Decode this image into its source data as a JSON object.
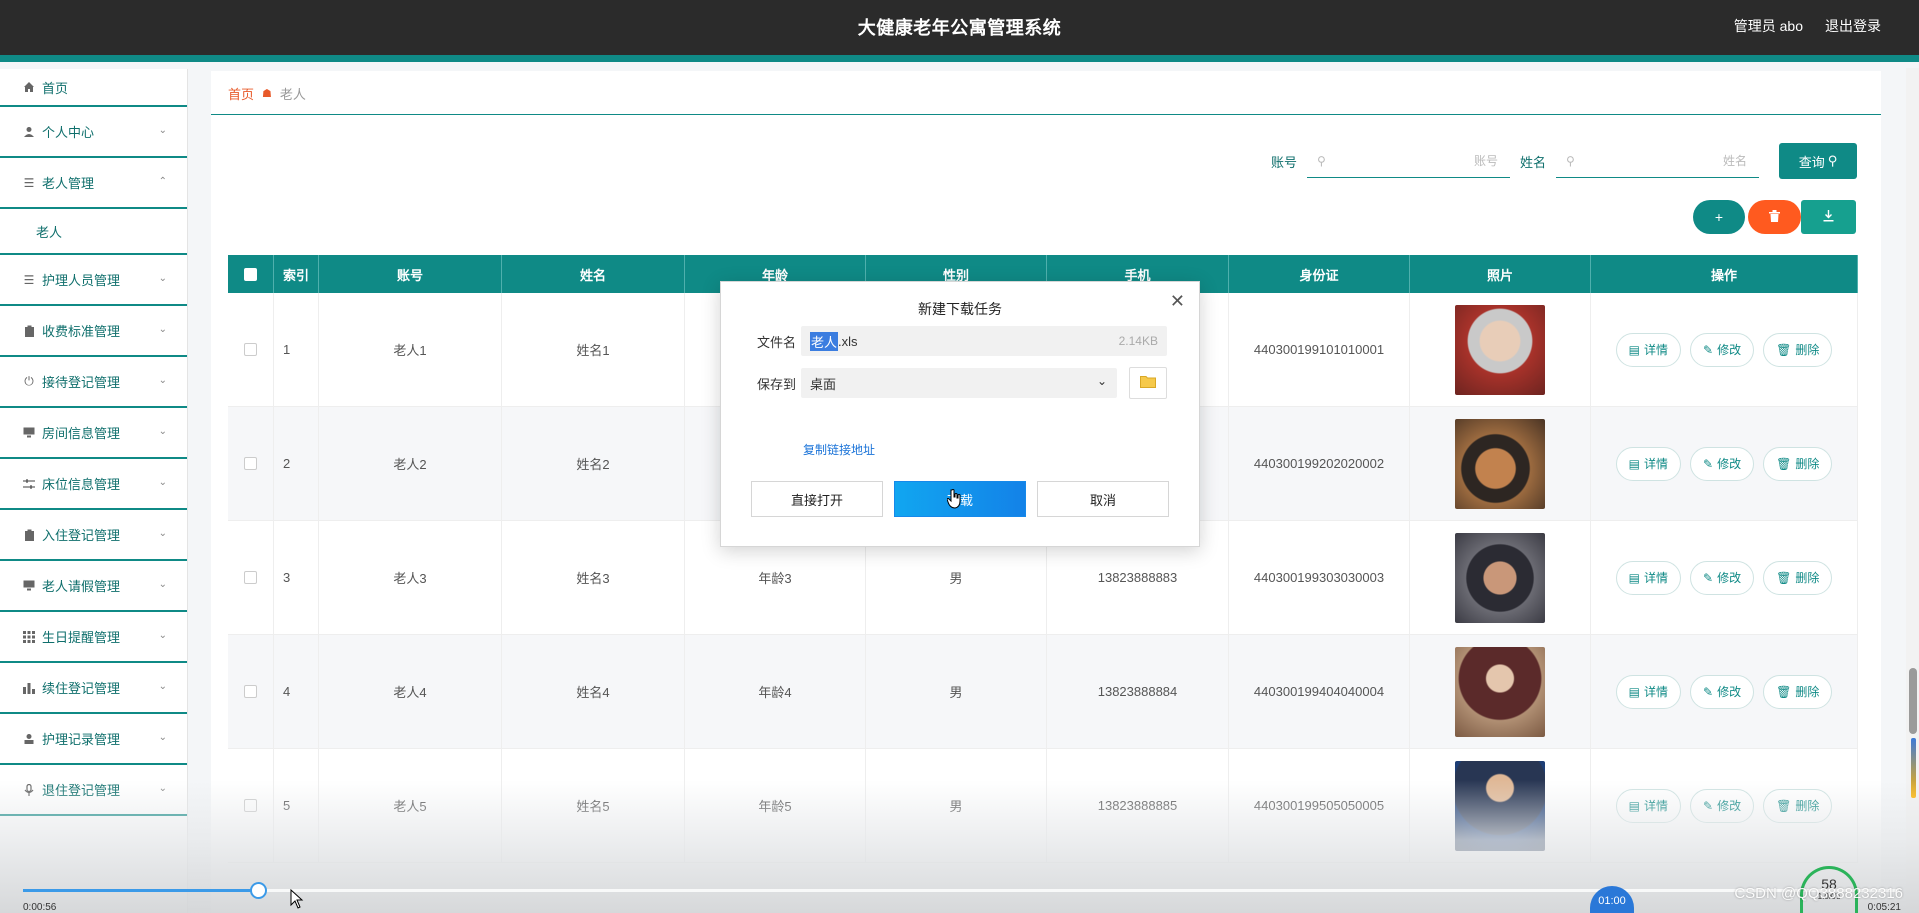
{
  "header": {
    "title": "大健康老年公寓管理系统",
    "user": "管理员 abo",
    "logout": "退出登录"
  },
  "sidebar": {
    "items": [
      {
        "label": "首页",
        "icon": "home-icon",
        "expandable": false
      },
      {
        "label": "个人中心",
        "icon": "user-icon",
        "expandable": true
      },
      {
        "label": "老人管理",
        "icon": "list-icon",
        "expandable": true,
        "expanded": true,
        "children": [
          "老人"
        ]
      },
      {
        "label": "护理人员管理",
        "icon": "list-icon",
        "expandable": true
      },
      {
        "label": "收费标准管理",
        "icon": "clipboard-icon",
        "expandable": true
      },
      {
        "label": "接待登记管理",
        "icon": "power-icon",
        "expandable": true
      },
      {
        "label": "房间信息管理",
        "icon": "monitor-icon",
        "expandable": true
      },
      {
        "label": "床位信息管理",
        "icon": "sliders-icon",
        "expandable": true
      },
      {
        "label": "入住登记管理",
        "icon": "clipboard-icon",
        "expandable": true
      },
      {
        "label": "老人请假管理",
        "icon": "monitor-icon",
        "expandable": true
      },
      {
        "label": "生日提醒管理",
        "icon": "grid-icon",
        "expandable": true
      },
      {
        "label": "续住登记管理",
        "icon": "bar-chart-icon",
        "expandable": true
      },
      {
        "label": "护理记录管理",
        "icon": "person-icon",
        "expandable": true
      },
      {
        "label": "退住登记管理",
        "icon": "mic-icon",
        "expandable": true
      }
    ]
  },
  "breadcrumb": {
    "home": "首页",
    "current": "老人"
  },
  "search": {
    "account_label": "账号",
    "account_placeholder": "账号",
    "name_label": "姓名",
    "name_placeholder": "姓名",
    "query_label": "查询"
  },
  "actions": {
    "add": "+",
    "delete_icon": "trash-icon",
    "export_icon": "download-icon"
  },
  "table": {
    "headers": [
      "索引",
      "账号",
      "姓名",
      "年龄",
      "性别",
      "手机",
      "身份证",
      "照片",
      "操作"
    ],
    "rows": [
      {
        "index": "1",
        "account": "老人1",
        "name": "姓名1",
        "age": "",
        "sex": "",
        "phone": "",
        "idcard": "440300199101010001"
      },
      {
        "index": "2",
        "account": "老人2",
        "name": "姓名2",
        "age": "",
        "sex": "",
        "phone": "",
        "idcard": "440300199202020002"
      },
      {
        "index": "3",
        "account": "老人3",
        "name": "姓名3",
        "age": "年龄3",
        "sex": "男",
        "phone": "13823888883",
        "idcard": "440300199303030003"
      },
      {
        "index": "4",
        "account": "老人4",
        "name": "姓名4",
        "age": "年龄4",
        "sex": "男",
        "phone": "13823888884",
        "idcard": "440300199404040004"
      },
      {
        "index": "5",
        "account": "老人5",
        "name": "姓名5",
        "age": "年龄5",
        "sex": "男",
        "phone": "13823888885",
        "idcard": "440300199505050005"
      }
    ],
    "ops": {
      "detail": "详情",
      "edit": "修改",
      "delete": "删除"
    }
  },
  "dialog": {
    "title": "新建下载任务",
    "file_label": "文件名",
    "file_name_selected": "老人",
    "file_name_rest": ".xls",
    "file_size": "2.14KB",
    "save_label": "保存到",
    "save_location": "桌面",
    "copy_link": "复制链接地址",
    "open_direct": "直接打开",
    "download": "下载",
    "cancel": "取消"
  },
  "player": {
    "elapsed": "0:00:56",
    "total": "0:05:21",
    "progress": 0.125,
    "bubble_time": "01:00",
    "speed_value": "58",
    "speed_unit": "1.0K/s"
  },
  "watermark": "CSDN @QQ3888232316",
  "colors": {
    "primary": "#0f8a86",
    "danger": "#ff5a1f",
    "header_bg": "#2b2b2b",
    "dialog_primary": "#1382e8"
  }
}
